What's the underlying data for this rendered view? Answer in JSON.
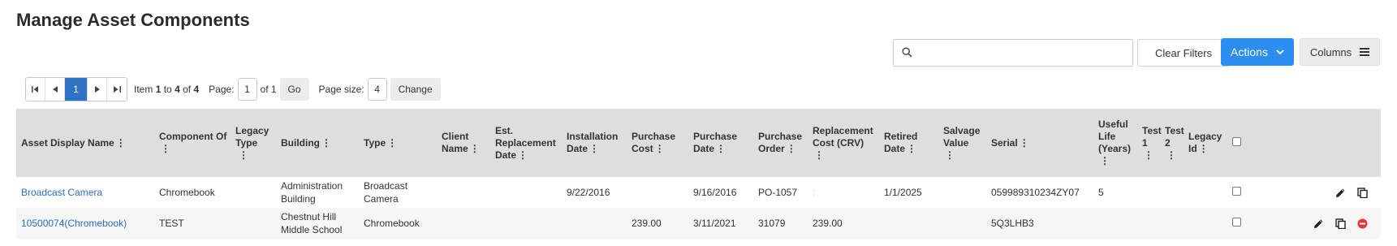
{
  "page": {
    "title": "Manage Asset Components"
  },
  "toolbar": {
    "search_placeholder": "",
    "clear_filters_label": "Clear Filters",
    "actions_label": "Actions",
    "columns_label": "Columns",
    "accent_color": "#2b8ef0"
  },
  "pager": {
    "current_page": "1",
    "item_text_prefix": "Item",
    "item_from": "1",
    "item_to_word": "to",
    "item_to": "4",
    "item_of_word": "of",
    "item_total": "4",
    "page_label": "Page:",
    "page_value": "1",
    "page_of": "of 1",
    "go_label": "Go",
    "page_size_label": "Page size:",
    "page_size_value": "4",
    "change_label": "Change"
  },
  "table": {
    "headers": [
      "Asset Display Name",
      "Component Of",
      "Legacy Type",
      "Building",
      "Type",
      "Client Name",
      "Est. Replacement Date",
      "Installation Date",
      "Purchase Cost",
      "Purchase Date",
      "Purchase Order",
      "Replacement Cost (CRV)",
      "Retired Date",
      "Salvage Value",
      "Serial",
      "Useful Life (Years)",
      "Test 1",
      "Test 2",
      "Legacy Id"
    ],
    "rows": [
      {
        "name": "Broadcast Camera",
        "component_of": "Chromebook",
        "legacy_type": "",
        "building": "Administration Building",
        "type": "Broadcast Camera",
        "client_name": "",
        "est_replacement_date": "",
        "installation_date": "9/22/2016",
        "purchase_cost": "",
        "purchase_date": "9/16/2016",
        "purchase_order": "PO-1057",
        "replacement_cost": ":",
        "retired_date": "1/1/2025",
        "salvage_value": "",
        "serial": "059989310234ZY07",
        "useful_life": "5",
        "test1": "",
        "test2": "",
        "legacy_id": ""
      },
      {
        "name": "10500074(Chromebook)",
        "component_of": "TEST",
        "legacy_type": "",
        "building": "Chestnut Hill Middle School",
        "type": "Chromebook",
        "client_name": "",
        "est_replacement_date": "",
        "installation_date": "",
        "purchase_cost": "239.00",
        "purchase_date": "3/11/2021",
        "purchase_order": "31079",
        "replacement_cost": "239.00",
        "retired_date": "",
        "salvage_value": "",
        "serial": "5Q3LHB3",
        "useful_life": "",
        "test1": "",
        "test2": "",
        "legacy_id": ""
      }
    ],
    "icons": [
      "pencil-icon",
      "copy-icon",
      "remove-icon"
    ]
  }
}
